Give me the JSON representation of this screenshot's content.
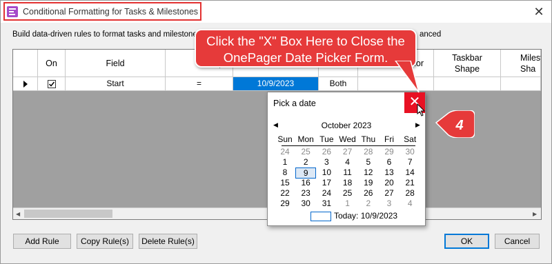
{
  "window": {
    "title": "Conditional Formatting for Tasks & Milestones",
    "close_glyph": "✕"
  },
  "instructions": {
    "lead": "Build data-driven rules to format tasks and milestone",
    "tail": "anced"
  },
  "grid": {
    "headers": [
      "On",
      "Field",
      "Ope",
      "olor",
      "Taskbar Shape",
      "Milest Sha"
    ],
    "row": {
      "on_checked": true,
      "field": "Start",
      "operator": "=",
      "date": "10/9/2023",
      "apply_to": "Both"
    }
  },
  "buttons": {
    "add_rule": "Add Rule",
    "copy_rules": "Copy Rule(s)",
    "delete_rules": "Delete Rule(s)",
    "ok": "OK",
    "cancel": "Cancel"
  },
  "callout": {
    "line1": "Click the \"X\" Box Here to Close the",
    "line2": "OnePager Date Picker Form.",
    "step_number": "4"
  },
  "date_picker": {
    "title": "Pick a date",
    "close_glyph": "✕",
    "month_label": "October 2023",
    "weekdays": [
      "Sun",
      "Mon",
      "Tue",
      "Wed",
      "Thu",
      "Fri",
      "Sat"
    ],
    "weeks": [
      [
        "24",
        "25",
        "26",
        "27",
        "28",
        "29",
        "30"
      ],
      [
        "1",
        "2",
        "3",
        "4",
        "5",
        "6",
        "7"
      ],
      [
        "8",
        "9",
        "10",
        "11",
        "12",
        "13",
        "14"
      ],
      [
        "15",
        "16",
        "17",
        "18",
        "19",
        "20",
        "21"
      ],
      [
        "22",
        "23",
        "24",
        "25",
        "26",
        "27",
        "28"
      ],
      [
        "29",
        "30",
        "31",
        "1",
        "2",
        "3",
        "4"
      ]
    ],
    "selected_day": "9",
    "today_label": "Today: 10/9/2023"
  },
  "colors": {
    "accent_red": "#e63a3a",
    "close_red": "#e81123",
    "selection_blue": "#0078d7"
  }
}
